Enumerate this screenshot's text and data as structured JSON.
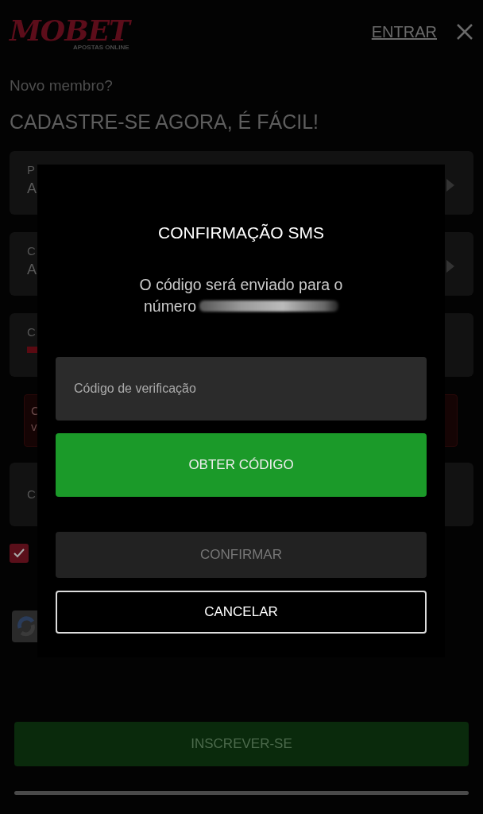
{
  "header": {
    "logo": "MOBET",
    "logo_tagline": "APOSTAS ONLINE",
    "login_link": "ENTRAR"
  },
  "intro": {
    "subtitle": "Novo membro?",
    "title": "CADASTRE-SE AGORA, É FÁCIL!"
  },
  "form_fields": [
    {
      "kind": "select",
      "label": "P",
      "value": "A"
    },
    {
      "kind": "select",
      "label": "C",
      "value": "A"
    },
    {
      "kind": "phone",
      "label": "C"
    },
    {
      "kind": "alert",
      "label": "C",
      "value": "v"
    },
    {
      "kind": "text",
      "label": "C"
    }
  ],
  "terms_checkbox": {
    "checked": true
  },
  "submit": {
    "label": "INSCREVER-SE",
    "disabled": true
  },
  "dialog": {
    "title": "CONFIRMAÇÃO SMS",
    "message_lines": [
      "O código será enviado para o",
      "número"
    ],
    "code_field": {
      "placeholder": "Código de verificação"
    },
    "buttons": [
      {
        "kind": "primary",
        "label": "OBTER CÓDIGO",
        "disabled": false
      },
      {
        "kind": "filled",
        "label": "CONFIRMAR",
        "disabled": true
      },
      {
        "kind": "outline",
        "label": "CANCELAR",
        "disabled": false
      }
    ]
  }
}
